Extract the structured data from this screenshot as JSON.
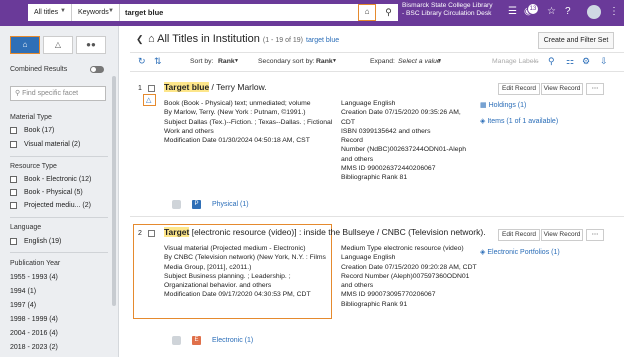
{
  "topbar": {
    "scope": "All titles",
    "field": "Keywords",
    "query": "target blue",
    "institution": "Bismarck State College Library - BSC Library Circulation Desk",
    "tasks_count": "13"
  },
  "sidebar": {
    "combined_results": "Combined Results",
    "find_placeholder": "Find specific facet",
    "material_type": {
      "title": "Material Type",
      "items": [
        "Book (17)",
        "Visual material (2)"
      ]
    },
    "resource_type": {
      "title": "Resource Type",
      "items": [
        "Book - Electronic (12)",
        "Book - Physical (5)",
        "Projected mediu... (2)"
      ]
    },
    "language": {
      "title": "Language",
      "items": [
        "English (19)"
      ]
    },
    "pub_year": {
      "title": "Publication Year",
      "items": [
        "1955 - 1993 (4)",
        "1994 (1)",
        "1997 (4)",
        "1998 - 1999 (4)",
        "2004 - 2016 (4)",
        "2018 - 2023 (2)"
      ]
    }
  },
  "main": {
    "title": "All Titles in Institution",
    "count": "(1 - 19 of 19)",
    "query": "target blue",
    "create_filter": "Create and Filter Set",
    "sort_label": "Sort by:",
    "sort_value": "Rank",
    "secondary_label": "Secondary sort by:",
    "secondary_value": "Rank",
    "expand_label": "Expand:",
    "expand_value": "Select a value",
    "manage_labels": "Manage Labels"
  },
  "records": [
    {
      "num": "1",
      "title_hl": "Target blue",
      "title_rest": " / Terry Marlow.",
      "left": [
        "Book (Book - Physical) text; unmediated; volume",
        "By Marlow, Terry. (New York : Putnam, ©1991.)",
        "Subject Dallas (Tex.)--Fiction. ; Texas--Dallas. ; Fictional",
        "Work and others",
        "Modification Date 01/30/2024 04:50:18 AM, CST"
      ],
      "right": [
        "Language English",
        "Creation Date 07/15/2020 09:35:26 AM,",
        "CDT",
        "ISBN 0399135642 and others",
        "Record",
        "Number (NdBC)002637244ODN01-Aleph",
        "and others",
        "MMS ID 990026372440206067",
        "Bibliographic Rank 81"
      ],
      "edit": "Edit Record",
      "view": "View Record",
      "holdings": "Holdings (1)",
      "items": "Items (1 of 1 available)",
      "inventory": "Physical (1)",
      "type_letter": "P"
    },
    {
      "num": "2",
      "title_hl": "Target",
      "title_rest": " [electronic resource (video)] : inside the Bullseye / CNBC (Television network).",
      "left": [
        "Visual material (Projected medium - Electronic)",
        "By CNBC (Television network) (New York, N.Y. : Films",
        "Media Group, [2011], c2011.)",
        "Subject Business planning. ; Leadership. ;",
        "Organizational behavior. and others",
        "Modification Date 09/17/2020 04:30:53 PM, CDT"
      ],
      "right": [
        "Medium Type electronic resource (video)",
        "Language English",
        "Creation Date 07/15/2020 09:20:28 AM, CDT",
        "Record Number (Aleph)007597360ODN01",
        "and others",
        "MMS ID 990073095770206067",
        "Bibliographic Rank 91"
      ],
      "edit": "Edit Record",
      "view": "View Record",
      "portfolios": "Electronic Portfolios (1)",
      "inventory": "Electronic (1)",
      "type_letter": "E"
    }
  ]
}
